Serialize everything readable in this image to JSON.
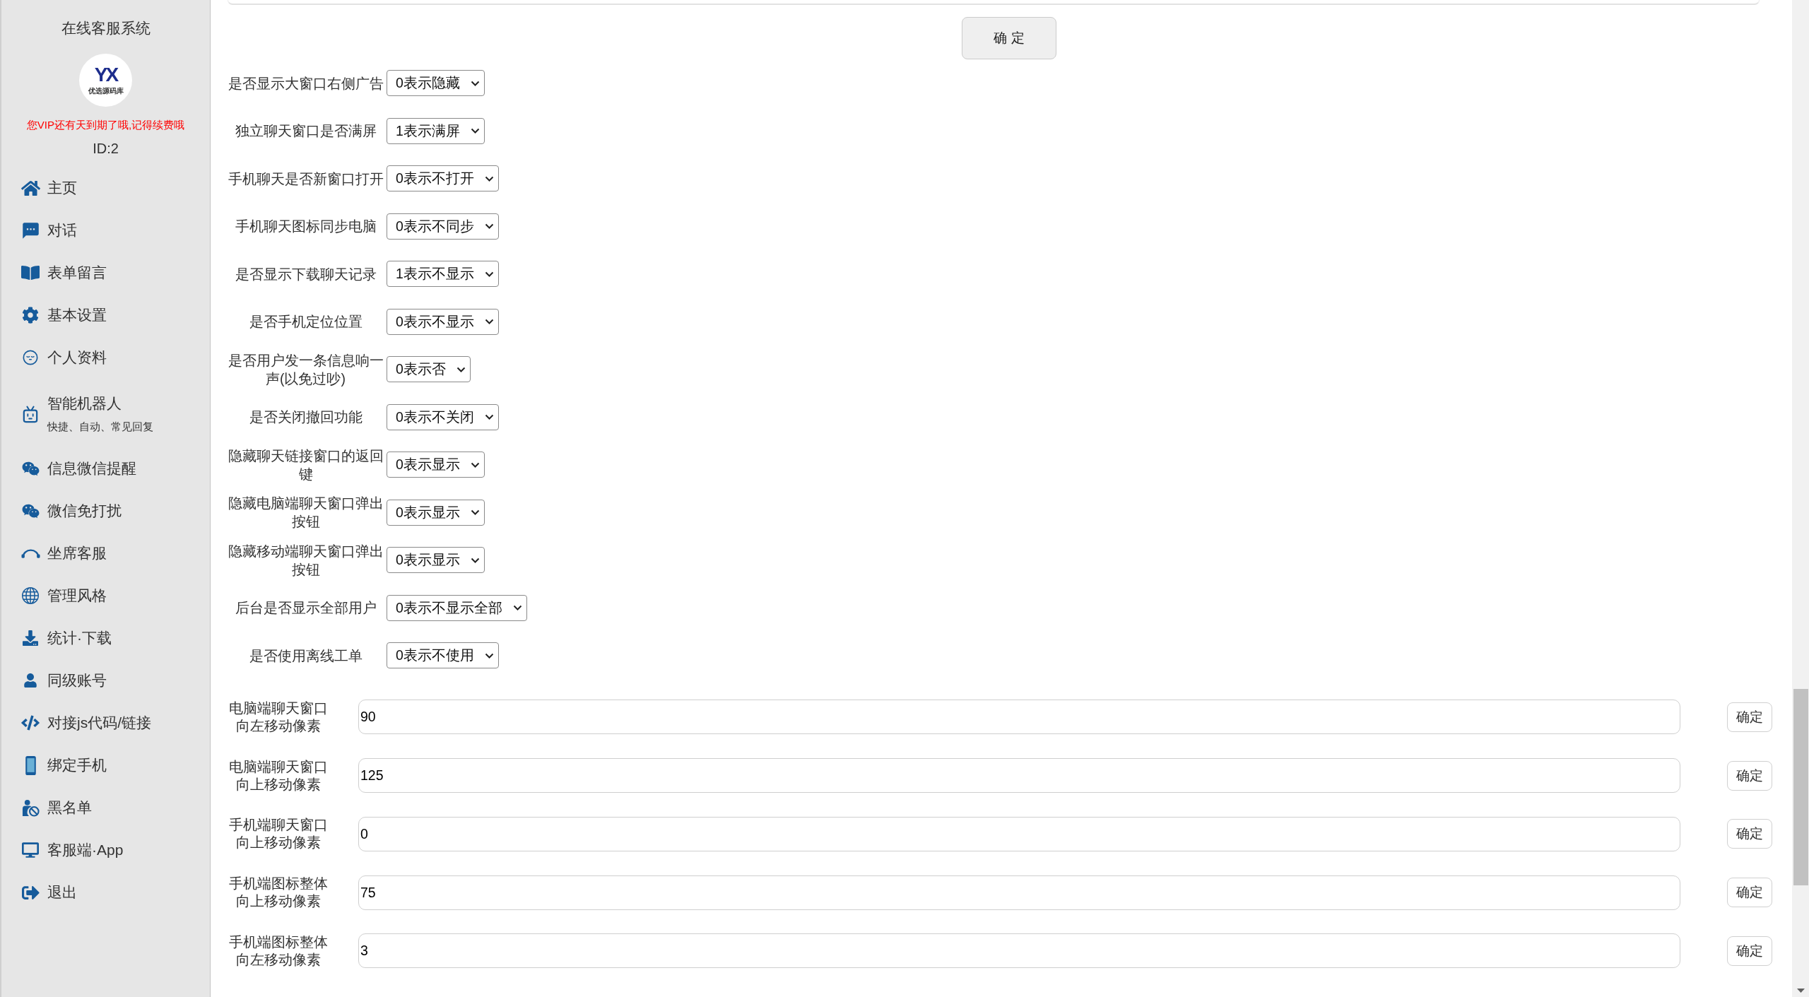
{
  "sidebar": {
    "title": "在线客服系统",
    "logo": {
      "mark": "YX",
      "name": "优选源码库"
    },
    "notice": "您VIP还有天到期了哦,记得续费哦",
    "account_id": "ID:2",
    "menu": [
      {
        "label": "主页"
      },
      {
        "label": "对话"
      },
      {
        "label": "表单留言"
      },
      {
        "label": "基本设置"
      },
      {
        "label": "个人资料"
      },
      {
        "label": "智能机器人",
        "subtitle": "快捷、自动、常见回复"
      },
      {
        "label": "信息微信提醒"
      },
      {
        "label": "微信免打扰"
      },
      {
        "label": "坐席客服"
      },
      {
        "label": "管理风格"
      },
      {
        "label": "统计·下载"
      },
      {
        "label": "同级账号"
      },
      {
        "label": "对接js代码/链接"
      },
      {
        "label": "绑定手机"
      },
      {
        "label": "黑名单"
      },
      {
        "label": "客服端·App"
      },
      {
        "label": "退出"
      }
    ]
  },
  "main": {
    "submit_button": "确 定",
    "settings": [
      {
        "label": "是否显示大窗口右侧广告",
        "value": "0表示隐藏"
      },
      {
        "label": "独立聊天窗口是否满屏",
        "value": "1表示满屏"
      },
      {
        "label": "手机聊天是否新窗口打开",
        "value": "0表示不打开"
      },
      {
        "label": "手机聊天图标同步电脑",
        "value": "0表示不同步"
      },
      {
        "label": "是否显示下载聊天记录",
        "value": "1表示不显示"
      },
      {
        "label": "是否手机定位位置",
        "value": "0表示不显示"
      },
      {
        "label": "是否用户发一条信息响一声(以免过吵)",
        "value": "0表示否"
      },
      {
        "label": "是否关闭撤回功能",
        "value": "0表示不关闭"
      },
      {
        "label": "隐藏聊天链接窗口的返回键",
        "value": "0表示显示"
      },
      {
        "label": "隐藏电脑端聊天窗口弹出按钮",
        "value": "0表示显示"
      },
      {
        "label": "隐藏移动端聊天窗口弹出按钮",
        "value": "0表示显示"
      },
      {
        "label": "后台是否显示全部用户",
        "value": "0表示不显示全部"
      },
      {
        "label": "是否使用离线工单",
        "value": "0表示不使用"
      }
    ],
    "offsets": [
      {
        "label": "电脑端聊天窗口向左移动像素",
        "value": "90",
        "button": "确定"
      },
      {
        "label": "电脑端聊天窗口向上移动像素",
        "value": "125",
        "button": "确定"
      },
      {
        "label": "手机端聊天窗口向上移动像素",
        "value": "0",
        "button": "确定"
      },
      {
        "label": "手机端图标整体向上移动像素",
        "value": "75",
        "button": "确定"
      },
      {
        "label": "手机端图标整体向左移动像素",
        "value": "3",
        "button": "确定"
      }
    ]
  }
}
